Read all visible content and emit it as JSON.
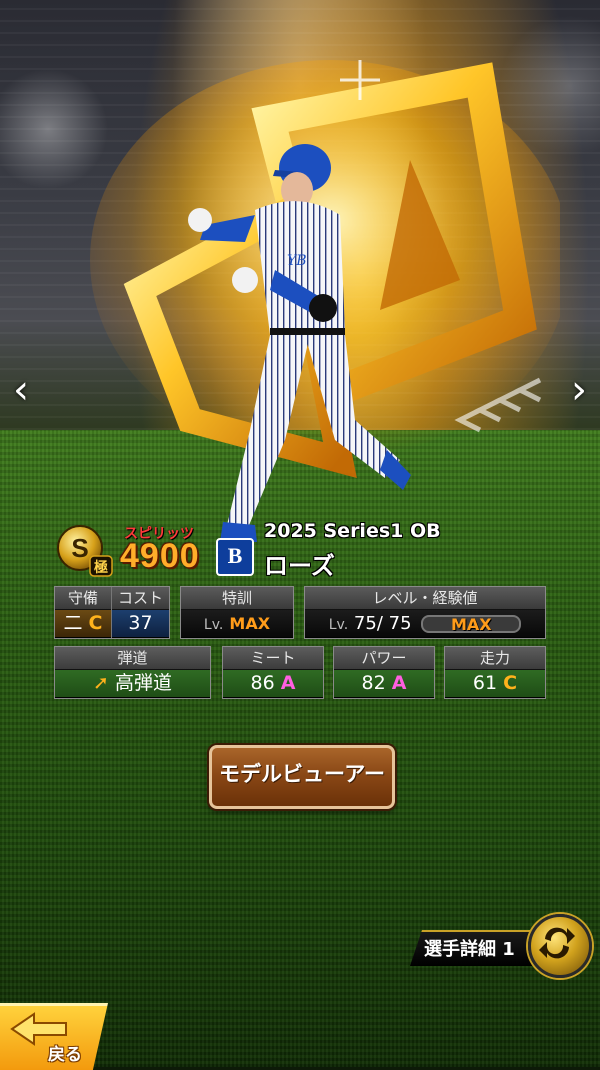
{
  "card": {
    "series": "2025 Series1 OB",
    "player_name": "ローズ",
    "rank_badge": "S",
    "rank_sub": "極",
    "spirits_label": "スピリッツ",
    "spirits_value": "4900",
    "team_logo": "B",
    "jersey_text": "YB"
  },
  "stats": {
    "defense_header": "守備",
    "defense_position": "二",
    "defense_grade": "C",
    "cost_header": "コスト",
    "cost_value": "37",
    "training_header": "特訓",
    "training_lv_prefix": "Lv.",
    "training_value": "MAX",
    "level_header": "レベル・経験値",
    "level_lv_prefix": "Lv.",
    "level_value": "75/ 75",
    "exp_value": "MAX",
    "trajectory_header": "弾道",
    "trajectory_value": "高弾道",
    "contact_header": "ミート",
    "contact_value": "86",
    "contact_grade": "A",
    "power_header": "パワー",
    "power_value": "82",
    "power_grade": "A",
    "speed_header": "走力",
    "speed_value": "61",
    "speed_grade": "C"
  },
  "buttons": {
    "model_viewer": "モデルビューアー",
    "player_detail": "選手詳細 1",
    "back": "戻る",
    "prev_icon": "chevron-left-icon",
    "next_icon": "chevron-right-icon"
  },
  "colors": {
    "grade_a": "#ff5fe0",
    "grade_c": "#ffb21c",
    "max_orange": "#ff9c1a",
    "stat_green": "#2f6b23",
    "button_brown": "#8a4816",
    "back_yellow": "#f39a0d"
  }
}
